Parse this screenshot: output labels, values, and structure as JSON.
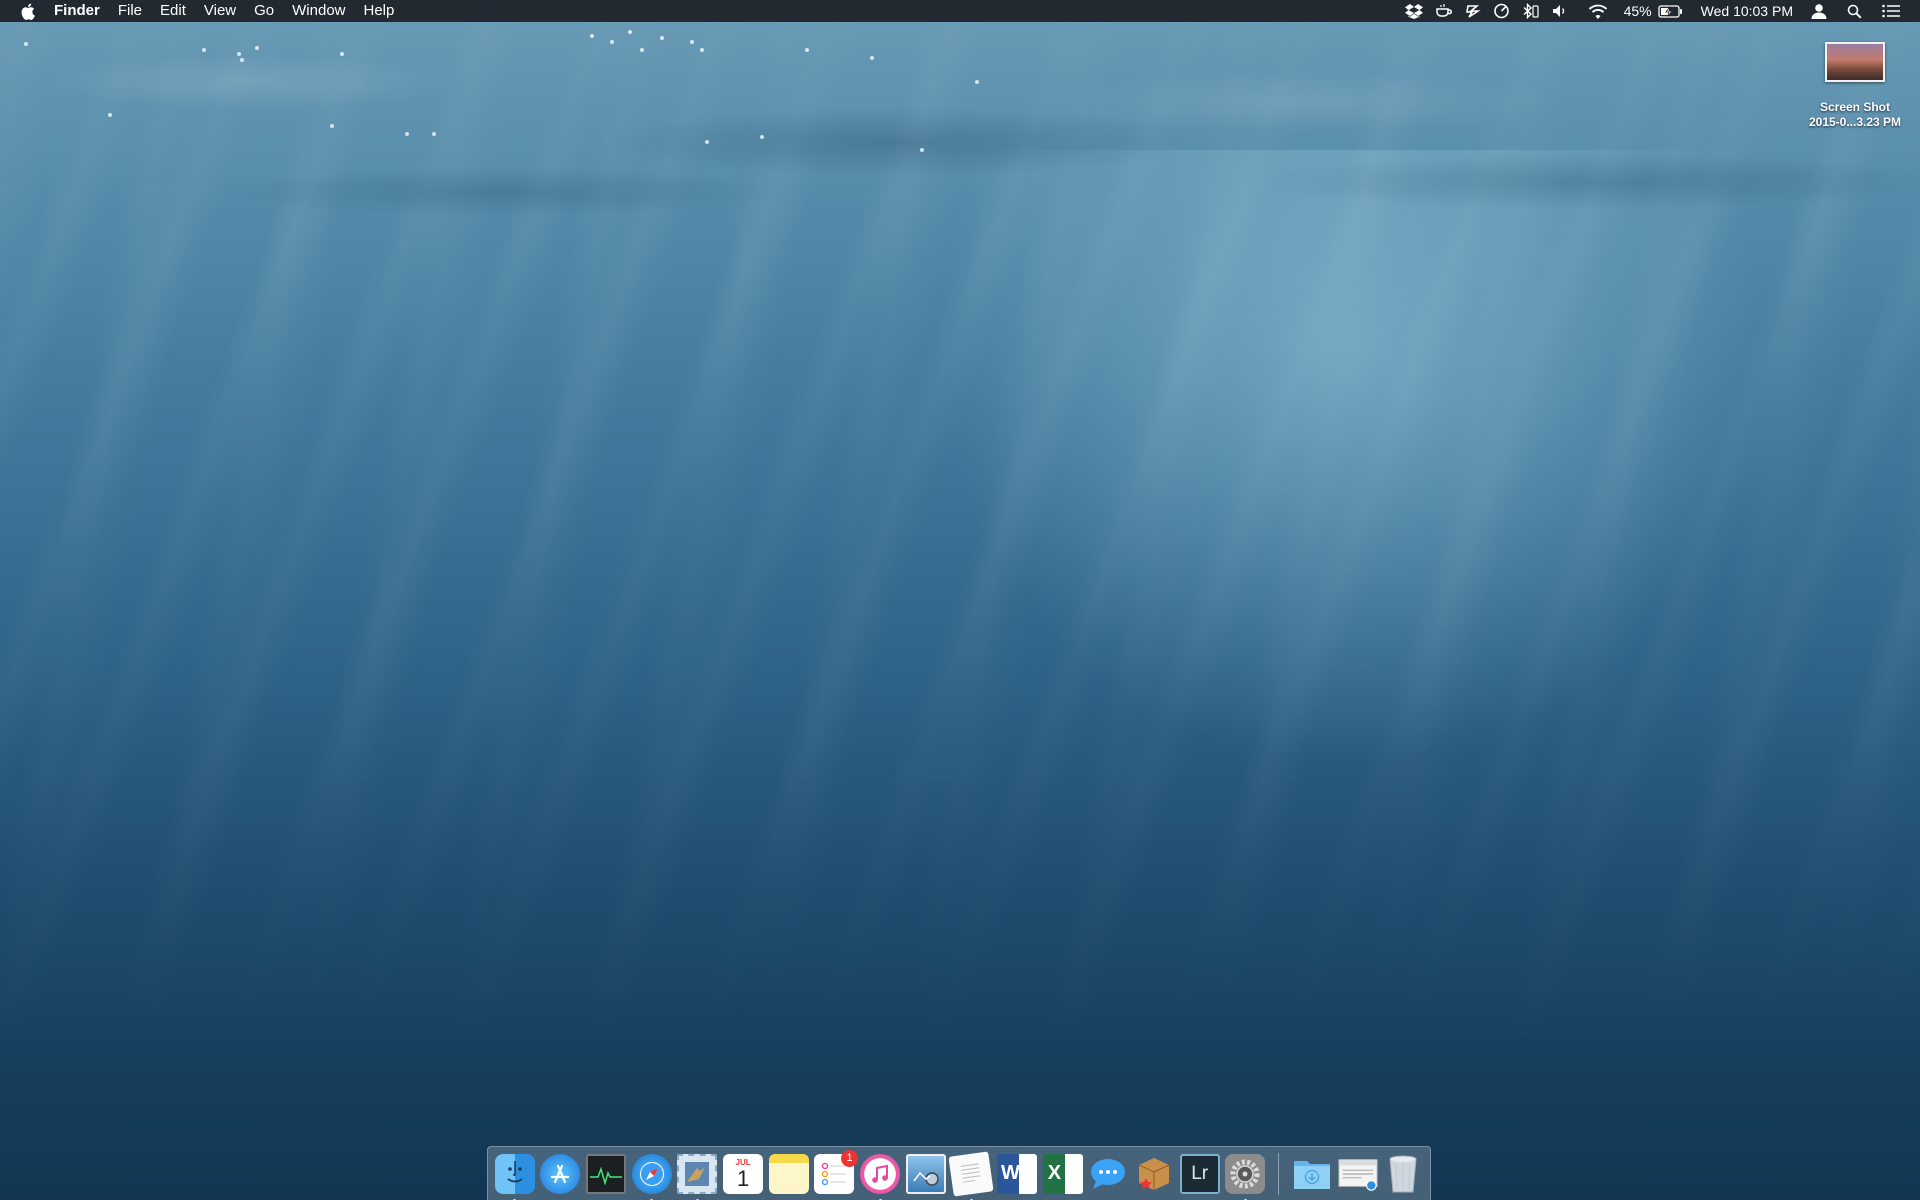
{
  "menubar": {
    "app_name": "Finder",
    "menus": [
      "File",
      "Edit",
      "View",
      "Go",
      "Window",
      "Help"
    ],
    "status_icons": [
      "dropbox-icon",
      "coffee-icon",
      "evernote-icon",
      "performance-icon",
      "bluetooth-icon",
      "volume-icon",
      "wifi-icon"
    ],
    "battery_percent": "45%",
    "clock": "Wed 10:03 PM"
  },
  "desktop": {
    "file": {
      "label_line1": "Screen Shot",
      "label_line2": "2015-0...3.23 PM"
    }
  },
  "dock": {
    "calendar": {
      "month": "JUL",
      "day": "1"
    },
    "reminders_badge": "1",
    "word_letter": "W",
    "excel_letter": "X",
    "lightroom_letter": "Lr"
  }
}
